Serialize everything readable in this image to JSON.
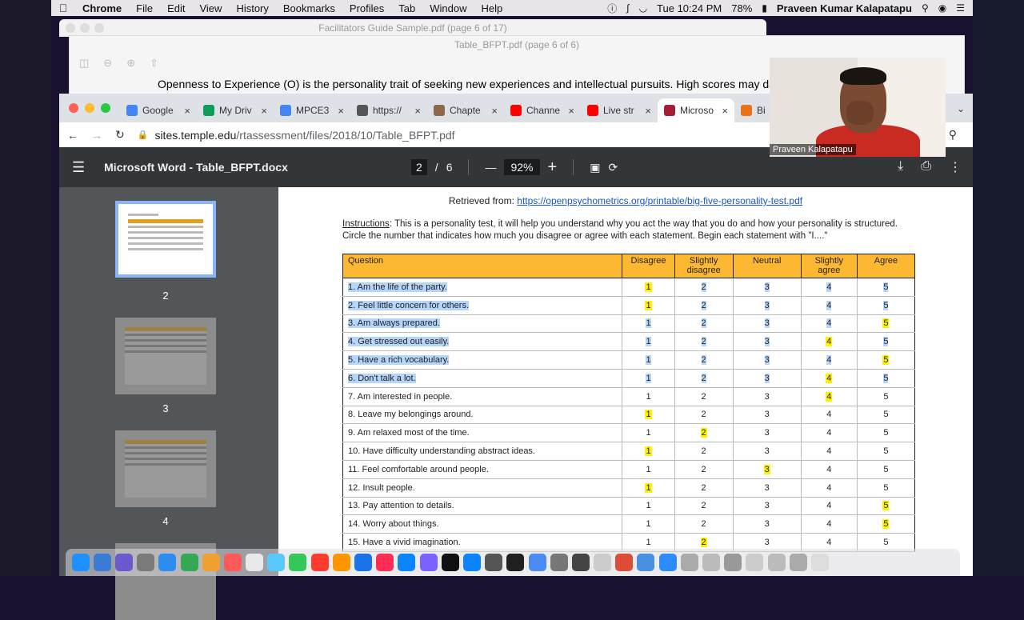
{
  "menubar": {
    "app": "Chrome",
    "items": [
      "File",
      "Edit",
      "View",
      "History",
      "Bookmarks",
      "Profiles",
      "Tab",
      "Window",
      "Help"
    ],
    "clock": "Tue 10:24 PM",
    "battery": "78%",
    "user": "Praveen Kumar Kalapatapu"
  },
  "background_windows": {
    "win1_title": "Facilitators Guide Sample.pdf (page 6 of 17)",
    "win2_title": "Table_BFPT.pdf (page 6 of 6)",
    "win2_text": "Openness to Experience (O) is the personality trait of seeking new experiences and intellectual pursuits. High scores may day"
  },
  "tabs": [
    {
      "label": "Google",
      "color": "#4285f4"
    },
    {
      "label": "My Driv",
      "color": "#0f9d58"
    },
    {
      "label": "MPCE3",
      "color": "#4285f4"
    },
    {
      "label": "https://",
      "color": "#555555"
    },
    {
      "label": "Chapte",
      "color": "#8a6a4a"
    },
    {
      "label": "Channe",
      "color": "#ff0000"
    },
    {
      "label": "Live str",
      "color": "#ff0000"
    },
    {
      "label": "Microso",
      "color": "#a41e34"
    },
    {
      "label": "Bi",
      "color": "#e8711a"
    }
  ],
  "address": {
    "domain": "sites.temple.edu",
    "path": "/rtassessment/files/2018/10/Table_BFPT.pdf"
  },
  "pdf": {
    "title": "Microsoft Word - Table_BFPT.docx",
    "page": "2",
    "total": "6",
    "zoom": "92%",
    "thumbs": [
      "2",
      "3",
      "4"
    ]
  },
  "document": {
    "retrieved_label": "Retrieved from:",
    "retrieved_url": "https://openpsychometrics.org/printable/big-five-personality-test.pdf",
    "instructions_label": "Instructions",
    "instructions_text": ": This is a personality test, it will help you understand why you act the way that you do and how your personality is structured. Circle the number that indicates how much you disagree or agree with each statement. Begin each statement with \"I....\"",
    "headers": [
      "Question",
      "Disagree",
      "Slightly disagree",
      "Neutral",
      "Slightly agree",
      "Agree"
    ],
    "rows": [
      {
        "q": "1. Am the life of the party.",
        "hl": 1,
        "sel": true
      },
      {
        "q": "2. Feel little concern for others.",
        "hl": 1,
        "sel": true
      },
      {
        "q": "3. Am always prepared.",
        "hl": 5,
        "sel": true
      },
      {
        "q": "4. Get stressed out easily.",
        "hl": 4,
        "sel": true
      },
      {
        "q": "5. Have a rich vocabulary.",
        "hl": 5,
        "sel": true
      },
      {
        "q": "6. Don't talk a lot.",
        "hl": 4,
        "sel": true
      },
      {
        "q": "7. Am interested in people.",
        "hl": 4,
        "sel": false
      },
      {
        "q": "8. Leave my belongings around.",
        "hl": 1,
        "sel": false
      },
      {
        "q": "9. Am relaxed most of the time.",
        "hl": 2,
        "sel": false
      },
      {
        "q": "10. Have difficulty understanding abstract ideas.",
        "hl": 1,
        "sel": false
      },
      {
        "q": "11. Feel comfortable around people.",
        "hl": 3,
        "sel": false
      },
      {
        "q": "12. Insult people.",
        "hl": 1,
        "sel": false
      },
      {
        "q": "13. Pay attention to details.",
        "hl": 5,
        "sel": false
      },
      {
        "q": "14. Worry about things.",
        "hl": 5,
        "sel": false
      },
      {
        "q": "15. Have a vivid imagination.",
        "hl": 2,
        "sel": false
      }
    ]
  },
  "video": {
    "name": "Praveen Kalapatapu"
  },
  "dock_colors": [
    "#1e90ff",
    "#3a7bd5",
    "#6a5acd",
    "#7a7a7a",
    "#2d8cf0",
    "#34a853",
    "#f0a030",
    "#ff5a5a",
    "#e8e8e8",
    "#5ac8fa",
    "#34c759",
    "#ff3b30",
    "#ff9500",
    "#1a73e8",
    "#ff2d55",
    "#0a84ff",
    "#7b61ff",
    "#111111",
    "#0a84ff",
    "#555555",
    "#1f1f1f",
    "#4c8bf5",
    "#777777",
    "#444444",
    "#cccccc",
    "#dd4b39",
    "#4a90e2",
    "#2d8cff",
    "#aaaaaa",
    "#bbbbbb",
    "#999999",
    "#cccccc",
    "#bbbbbb",
    "#aaaaaa",
    "#dddddd"
  ]
}
